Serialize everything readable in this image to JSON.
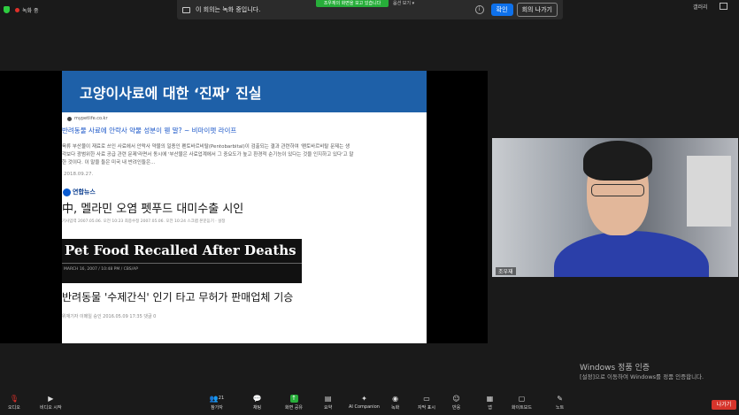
{
  "topbar": {
    "recording_label": "녹화 중",
    "gallery_view": "갤러리",
    "green_pill": "조우재의 화면을 보고 있습니다",
    "view_dropdown": "옵션 보기"
  },
  "banner": {
    "text": "이 회의는 녹화 중입니다.",
    "confirm": "확인",
    "leave_meeting": "회의 나가기"
  },
  "slide": {
    "title": "고양이사료에 대한 ‘진짜’ 진실",
    "article1": {
      "site": "mypetlife.co.kr",
      "title": "반려동물 사료에 안락사 약물 성분이 웬 말? ~ 비마이펫 라이프",
      "body": "육류 부산물이 재료로 쓰인 사료에서 안락사 약물의 일종인 펜토바르비탈(Pentobarbital)이 검출되는 결과 관련하여 '펜토바르비탈 문제는 생각보다 광범위한 사료 공급 관련 문제'라면서 동시에 '부산물은 사료업계에서 그 중요도가 높고 환경적 순기능이 있다는 것을 인지하고 있다'고 말한 것이다. 이 말을 들은 미국 내 반려인들은...",
      "date": "2018.09.27."
    },
    "article2": {
      "source": "연합뉴스",
      "title": "中, 멜라민 오염 펫푸드 대미수출 시인",
      "meta": "기사입력 2007.05.06. 오전 10:23  최종수정 2007.05.06. 오전 10:24  스크랩  본문듣기 · 설정"
    },
    "article3": {
      "banner_title": "Pet Food Recalled After Deaths",
      "banner_date": "MARCH 16, 2007 / 10:48 PM / CBS/AP",
      "title": "반려동물 '수제간식' 인기 타고 무허가 판매업체 기승",
      "meta": "위재기자 이메일   승인 2016.05.09 17:35   댓글 0"
    }
  },
  "webcam": {
    "name": "조우재"
  },
  "windows": {
    "activate": "Windows 정품 인증",
    "activate_sub": "[설정]으로 이동하여 Windows를 정품 인증합니다."
  },
  "toolbar": {
    "audio": "오디오",
    "video": "비디오 시작",
    "participants": "참가자",
    "participants_count": "21",
    "chat": "채팅",
    "share": "화면 공유",
    "summary": "요약",
    "ai": "AI Companion",
    "record": "녹화",
    "captions": "자막 표시",
    "reactions": "반응",
    "apps": "앱",
    "whiteboard": "화이트보드",
    "notes": "노트",
    "leave": "나가기"
  }
}
